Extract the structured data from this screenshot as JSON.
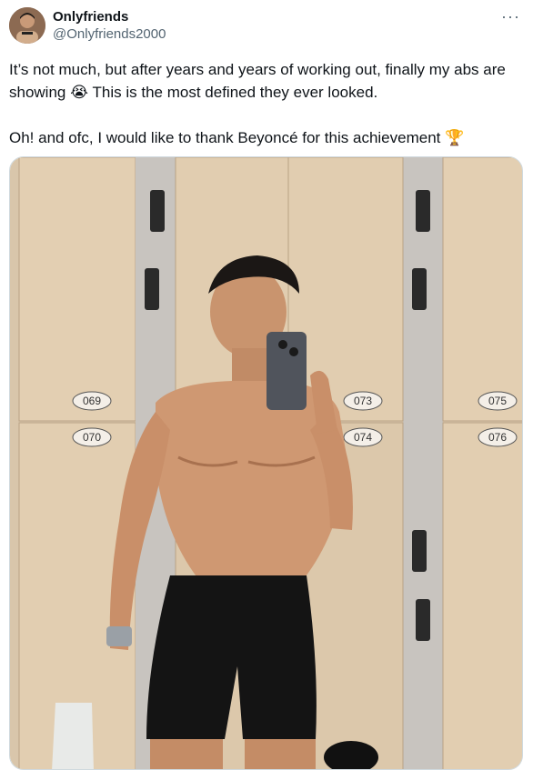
{
  "author": {
    "display_name": "Onlyfriends",
    "handle": "@Onlyfriends2000",
    "avatar_icon": "profile-avatar"
  },
  "menu": {
    "icon": "more-horizontal-icon",
    "glyph": "···"
  },
  "tweet": {
    "line1": "It’s not much, but after years and years of working out, finally my abs are showing ",
    "emoji1": "😭",
    "line1_tail": " This is the most defined they ever looked.",
    "line2": "Oh! and ofc, I would like to thank Beyoncé for this achievement ",
    "emoji2": "🏆"
  },
  "media": {
    "description_icon": "photo-image",
    "locker_numbers": [
      "069",
      "070",
      "073",
      "074",
      "075",
      "076"
    ]
  }
}
